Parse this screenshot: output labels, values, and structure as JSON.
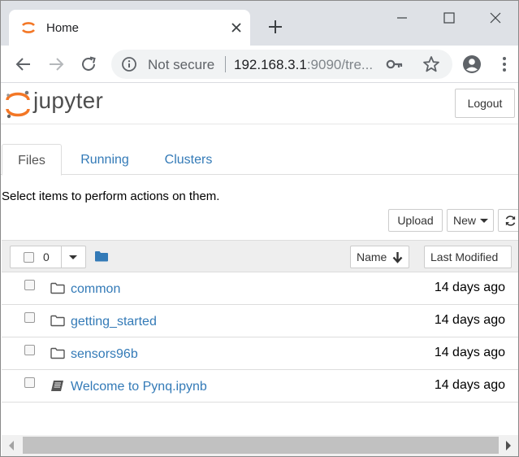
{
  "browser": {
    "tab_title": "Home",
    "security_label": "Not secure",
    "url_host": "192.168.3.1",
    "url_rest": ":9090/tre..."
  },
  "jupyter": {
    "wordmark": "jupyter",
    "logout_label": "Logout",
    "tabs": [
      {
        "label": "Files",
        "active": true
      },
      {
        "label": "Running",
        "active": false
      },
      {
        "label": "Clusters",
        "active": false
      }
    ],
    "hint": "Select items to perform actions on them.",
    "upload_label": "Upload",
    "new_label": "New",
    "selected_count": "0",
    "sort_name_label": "Name",
    "sort_modified_label": "Last Modified",
    "items": [
      {
        "name": "common",
        "type": "folder",
        "modified": "14 days ago"
      },
      {
        "name": "getting_started",
        "type": "folder",
        "modified": "14 days ago"
      },
      {
        "name": "sensors96b",
        "type": "folder",
        "modified": "14 days ago"
      },
      {
        "name": "Welcome to Pynq.ipynb",
        "type": "notebook",
        "modified": "14 days ago"
      }
    ]
  },
  "colors": {
    "link": "#337ab7",
    "jupyter_orange": "#f37726",
    "tabstrip": "#dee1e6"
  }
}
